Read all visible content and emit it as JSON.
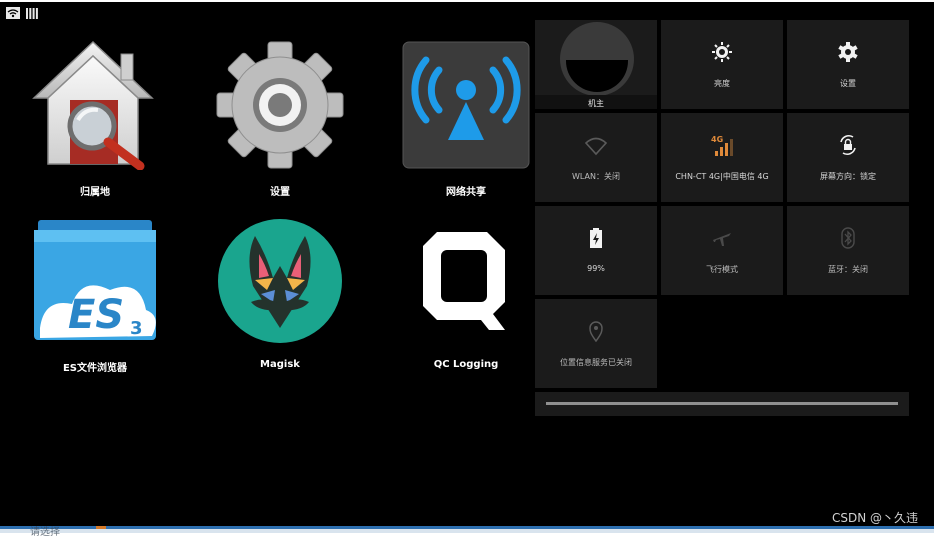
{
  "status_bar": {
    "icons": [
      "wifi-icon",
      "signal-icon"
    ]
  },
  "apps": [
    {
      "label": "归属地",
      "icon": "home-search-icon"
    },
    {
      "label": "设置",
      "icon": "gear-icon"
    },
    {
      "label": "网络共享",
      "icon": "hotspot-icon"
    },
    {
      "label": "ES文件浏览器",
      "icon": "es-file-explorer-icon"
    },
    {
      "label": "Magisk",
      "icon": "magisk-icon"
    },
    {
      "label": "QC Logging",
      "icon": "qc-logging-icon"
    }
  ],
  "quick_settings": {
    "owner": "机主",
    "brightness": "亮度",
    "settings": "设置",
    "wlan": "WLAN：关闭",
    "cellular": "CHN-CT 4G|中国电信 4G",
    "cellular_badge": "4G",
    "rotation": "屏幕方向：锁定",
    "battery": "99%",
    "airplane": "飞行模式",
    "bluetooth": "蓝牙：关闭",
    "location": "位置信息服务已关闭"
  },
  "watermark": "CSDN @丶久违",
  "background_fragment": "请选择",
  "colors": {
    "accent_blue": "#1e9be9",
    "tile_bg": "#1b1b1b",
    "signal_orange": "#e08a3a"
  }
}
